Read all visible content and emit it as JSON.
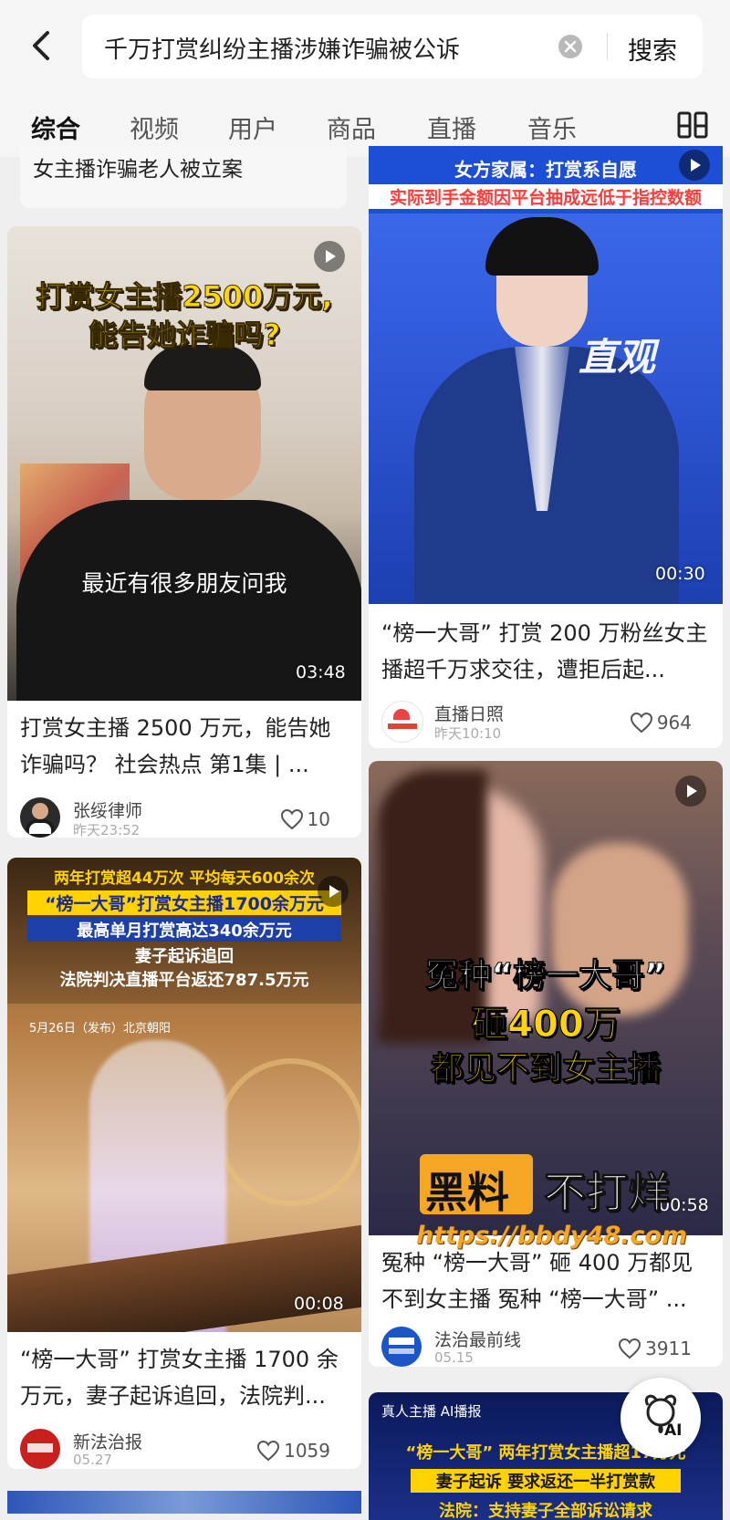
{
  "search": {
    "query": "千万打赏纠纷主播涉嫌诈骗被公诉",
    "button": "搜索"
  },
  "tabs": [
    "综合",
    "视频",
    "用户",
    "商品",
    "直播",
    "音乐"
  ],
  "cards": {
    "top_left": {
      "title": "女主播诈骗老人被立案"
    },
    "left1": {
      "overlay_title_1": "打赏女主播2500万元,",
      "overlay_title_2": "能告她诈骗吗?",
      "subtitle": "最近有很多朋友问我",
      "duration": "03:48",
      "title": "打赏女主播 2500 万元，能告她诈骗吗？ 社会热点 第1集 | ...",
      "author": "张绥律师",
      "time": "昨天23:52",
      "likes": "10"
    },
    "right1": {
      "banner_1": "女方家属：打赏系自愿",
      "banner_2": "实际到手金额因平台抽成远低于指控数额",
      "logo": "直观",
      "duration": "00:30",
      "title": "“榜一大哥” 打赏 200 万粉丝女主播超千万求交往，遭拒后起...",
      "author": "直播日照",
      "time": "昨天10:10",
      "likes": "964"
    },
    "left2": {
      "line_1": "两年打赏超44万次 平均每天600余次",
      "line_2": "“榜一大哥”打赏女主播1700余万元",
      "line_3": "最高单月打赏高达340余万元",
      "line_4": "妻子起诉追回",
      "line_5": "法院判决直播平台返还787.5万元",
      "date_tag": "5月26日（发布）北京朝阳",
      "duration": "00:08",
      "title": "“榜一大哥” 打赏女主播 1700 余万元，妻子起诉追回，法院判...",
      "author": "新法治报",
      "time": "05.27",
      "likes": "1059"
    },
    "right2": {
      "overlay_1": "冤种“榜一大哥”",
      "overlay_2": "砸400万",
      "overlay_3": "都见不到女主播",
      "duration": "00:58",
      "title": "冤种 “榜一大哥” 砸 400 万都见不到女主播 冤种 “榜一大哥” ...",
      "author": "法治最前线",
      "time": "05.15",
      "likes": "3911"
    },
    "right3": {
      "tag": "真人主播 AI播报",
      "line_1": "“榜一大哥” 两年打赏女主播超17万元",
      "line_2": "妻子起诉 要求返还一半打赏款",
      "line_3": "法院：支持妻子全部诉讼请求"
    }
  },
  "watermark": {
    "brand_1": "黑料",
    "brand_2": "不打烊",
    "url": "https://bbdy48.com"
  },
  "ai_button": "AI",
  "colors": {
    "accent": "#f5a623",
    "news_blue": "#1c4fd6"
  }
}
